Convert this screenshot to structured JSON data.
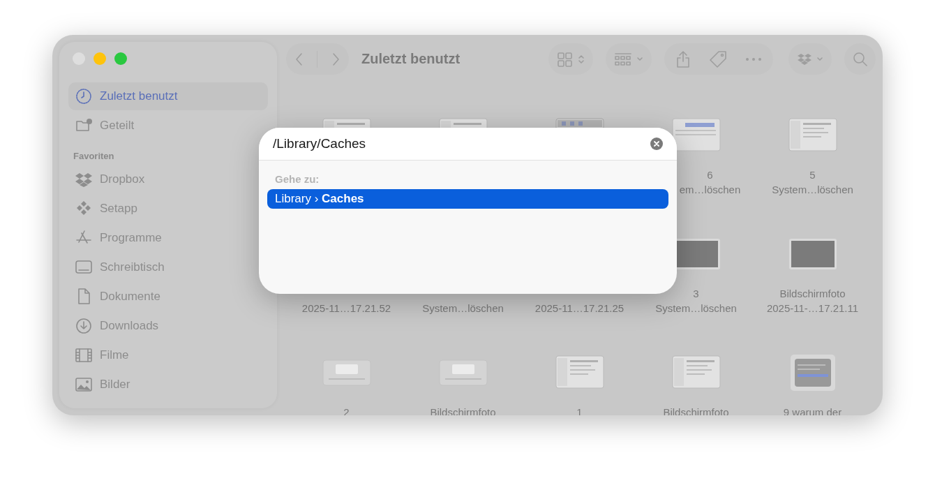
{
  "window": {
    "title": "Zuletzt benutzt"
  },
  "sidebar": {
    "items": [
      {
        "kind": "item",
        "label": "Zuletzt benutzt",
        "selected": true
      },
      {
        "kind": "item",
        "label": "Geteilt",
        "selected": false
      },
      {
        "kind": "section",
        "label": "Favoriten"
      },
      {
        "kind": "item",
        "label": "Dropbox",
        "selected": false
      },
      {
        "kind": "item",
        "label": "Setapp",
        "selected": false
      },
      {
        "kind": "item",
        "label": "Programme",
        "selected": false
      },
      {
        "kind": "item",
        "label": "Schreibtisch",
        "selected": false
      },
      {
        "kind": "item",
        "label": "Dokumente",
        "selected": false
      },
      {
        "kind": "item",
        "label": "Downloads",
        "selected": false
      },
      {
        "kind": "item",
        "label": "Filme",
        "selected": false
      },
      {
        "kind": "item",
        "label": "Bilder",
        "selected": false
      }
    ]
  },
  "files": [
    {
      "kind": "window"
    },
    {
      "kind": "window"
    },
    {
      "kind": "toolbar"
    },
    {
      "kind": "table",
      "line_1": "6",
      "line_2": "em…löschen",
      "cut_at_start": true
    },
    {
      "kind": "window",
      "line_1": "5",
      "line_2": "System…löschen"
    },
    {
      "line_2": "2025-11…17.21.52"
    },
    {
      "line_2": "System…löschen"
    },
    {
      "line_2": "2025-11…17.21.25"
    },
    {
      "kind": "dark",
      "line_1": "3",
      "line_2": "System…löschen"
    },
    {
      "kind": "dark",
      "line_1": "Bildschirmfoto",
      "line_2": "2025-11-…17.21.11"
    },
    {
      "kind": "panel",
      "line_1": "2"
    },
    {
      "kind": "panel",
      "line_1": "Bildschirmfoto"
    },
    {
      "kind": "window",
      "line_1": "1"
    },
    {
      "kind": "window",
      "line_1": "Bildschirmfoto"
    },
    {
      "kind": "card",
      "line_1": "9 warum der"
    }
  ],
  "dialog": {
    "value": "/Library/Caches",
    "section_label": "Gehe zu:",
    "results": [
      {
        "text": "Library › **Caches**",
        "selected": true
      }
    ]
  }
}
